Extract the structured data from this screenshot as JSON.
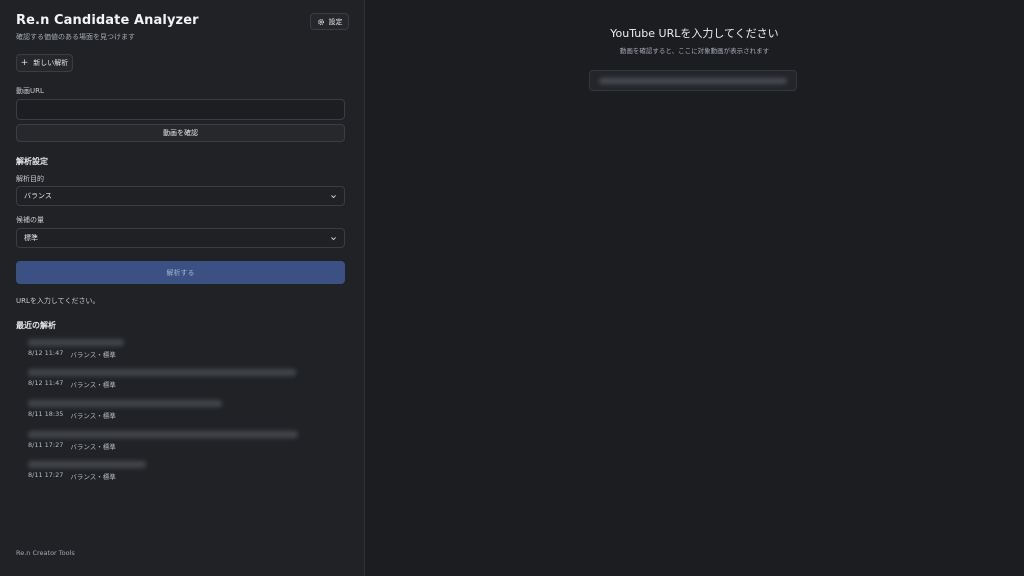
{
  "sidebar": {
    "title": "Re.n Candidate Analyzer",
    "subtitle": "確認する価値のある場面を見つけます",
    "settings_label": "設定",
    "new_analysis_label": "新しい解析",
    "url_label": "動画URL",
    "url_value": "",
    "url_placeholder": "",
    "confirm_label": "動画を確認",
    "settings_section": "解析設定",
    "purpose_label": "解析目的",
    "purpose_value": "バランス",
    "amount_label": "候補の量",
    "amount_value": "標準",
    "analyze_label": "解析する",
    "status_text": "URLを入力してください。",
    "recent_heading": "最近の解析",
    "recent_items": [
      {
        "date": "8/12 11:47",
        "settings": "バランス・標準"
      },
      {
        "date": "8/12 11:47",
        "settings": "バランス・標準"
      },
      {
        "date": "8/11 18:35",
        "settings": "バランス・標準"
      },
      {
        "date": "8/11 17:27",
        "settings": "バランス・標準"
      },
      {
        "date": "8/11 17:27",
        "settings": "バランス・標準"
      }
    ],
    "footer": "Re.n Creator Tools"
  },
  "main": {
    "prompt_title": "YouTube URLを入力してください",
    "prompt_subtitle": "動画を確認すると、ここに対象動画が表示されます"
  },
  "colors": {
    "accent": "#3b5184",
    "background": "#1b1d21",
    "sidebar": "#202226"
  },
  "icons": [
    "gear-icon",
    "plus-icon",
    "chevron-down-icon"
  ]
}
